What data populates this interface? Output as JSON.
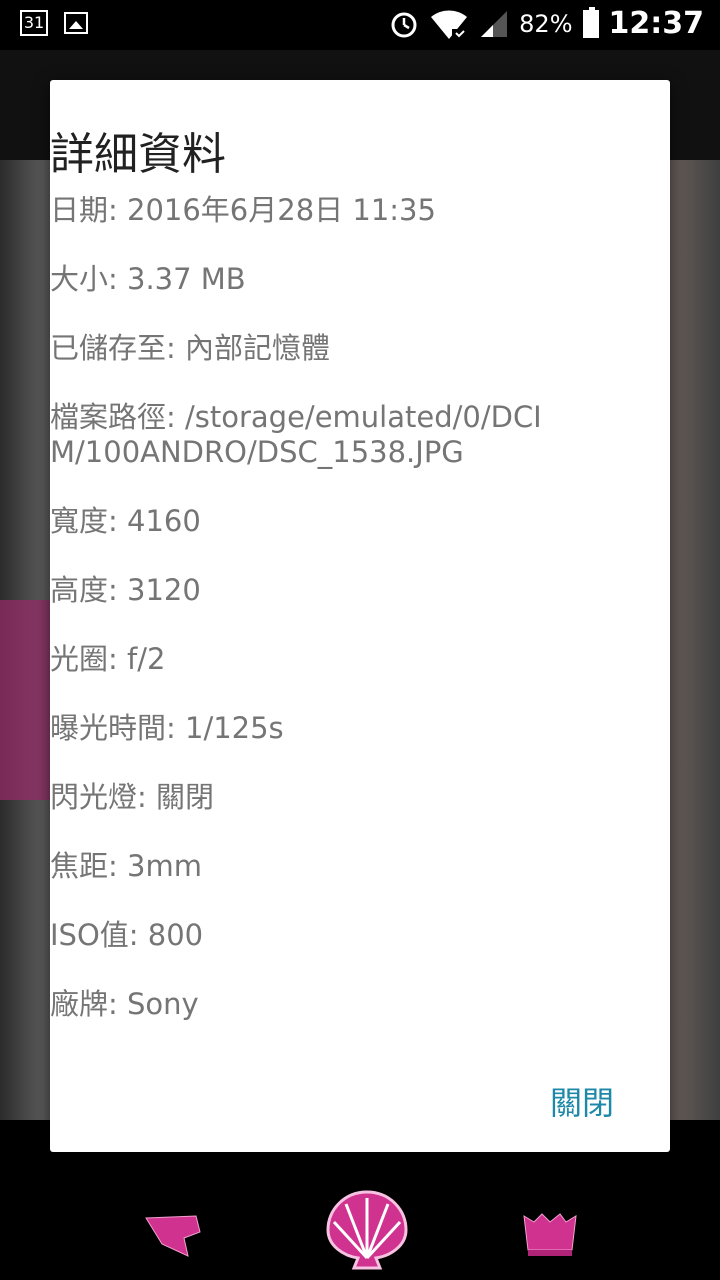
{
  "status_bar": {
    "calendar_day": "31",
    "battery_percent": "82%",
    "time": "12:37"
  },
  "dialog": {
    "title": "詳細資料",
    "rows": [
      "日期: 2016年6月28日 11:35",
      "大小: 3.37 MB",
      "已儲存至: 內部記憶體",
      "檔案路徑: /storage/emulated/0/DCIM/100ANDRO/DSC_1538.JPG",
      "寬度: 4160",
      "高度: 3120",
      "光圈: f/2",
      "曝光時間: 1/125s",
      "閃光燈: 關閉",
      "焦距: 3mm",
      "ISO值: 800",
      "廠牌: Sony"
    ],
    "close_label": "關閉"
  },
  "colors": {
    "accent": "#1e88a8",
    "nav_icon": "#d0338f"
  },
  "icons": [
    "calendar-icon",
    "gallery-icon",
    "alarm-icon",
    "wifi-icon",
    "signal-icon",
    "battery-icon",
    "flag-icon",
    "shell-icon",
    "crown-icon"
  ]
}
